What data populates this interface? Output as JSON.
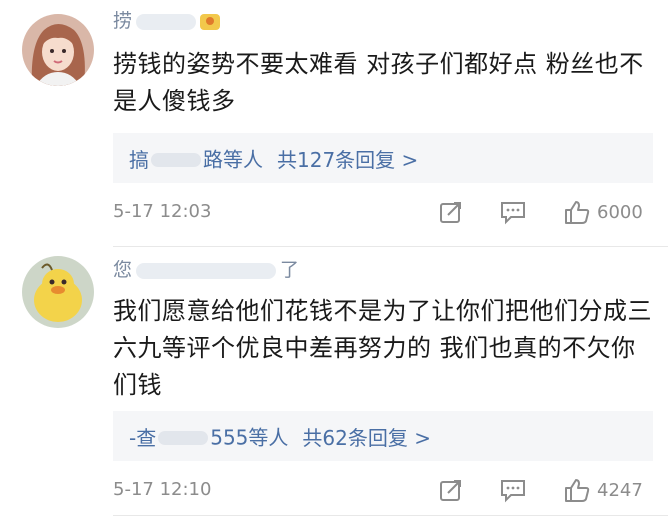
{
  "comments": [
    {
      "username": "捞",
      "text_line1": "捞钱的姿势不要太难看 对孩子们都好点 粉丝也不",
      "text_line2": "是人傻钱多",
      "reply_names": "搞",
      "reply_names_tail": "路等人",
      "reply_count": "共127条回复 >",
      "time": "5-17 12:03",
      "likes": "6000",
      "avatar_icon": "avatar-girl",
      "accent": "#4a6fa5"
    },
    {
      "username": "您",
      "username_tail": "了",
      "text_line1": "我们愿意给他们花钱不是为了让你们把他们分成三",
      "text_line2": "六九等评个优良中差再努力的 我们也真的不欠你",
      "text_line3": "们钱",
      "reply_names": "-查",
      "reply_names_tail": "555等人",
      "reply_count": "共62条回复 >",
      "time": "5-17 12:10",
      "likes": "4247",
      "avatar_icon": "avatar-duck",
      "accent": "#4a6fa5"
    }
  ],
  "icons": {
    "share": "share-icon",
    "comment": "comment-icon",
    "like": "like-icon"
  }
}
